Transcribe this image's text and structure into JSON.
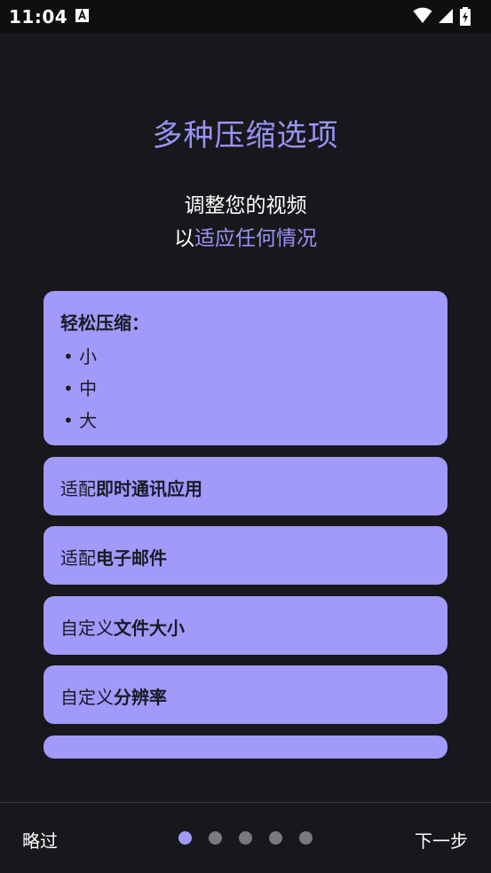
{
  "status_bar": {
    "time": "11:04",
    "icons": [
      "text-notification-icon",
      "wifi-icon",
      "cellular-signal-icon",
      "battery-charging-icon"
    ]
  },
  "onboarding": {
    "title": "多种压缩选项",
    "subtitle_line1": "调整您的视频",
    "subtitle_line2_prefix": "以",
    "subtitle_line2_accent": "适应任何情况"
  },
  "cards": {
    "easy": {
      "heading": "轻松压缩：",
      "options": [
        "• 小",
        "• 中",
        "• 大"
      ]
    },
    "messaging": {
      "prefix": "适配",
      "bold": "即时通讯应用"
    },
    "email": {
      "prefix": "适配",
      "bold": "电子邮件"
    },
    "file_size": {
      "prefix": "自定义",
      "bold": "文件大小"
    },
    "resolution": {
      "prefix": "自定义",
      "bold": "分辨率"
    }
  },
  "footer": {
    "skip_label": "略过",
    "next_label": "下一步",
    "page_count": 5,
    "current_page": 1
  },
  "colors": {
    "background": "#18171b",
    "accent": "#9a93f5",
    "card": "#a19afb",
    "dot_inactive": "#7a797f"
  }
}
